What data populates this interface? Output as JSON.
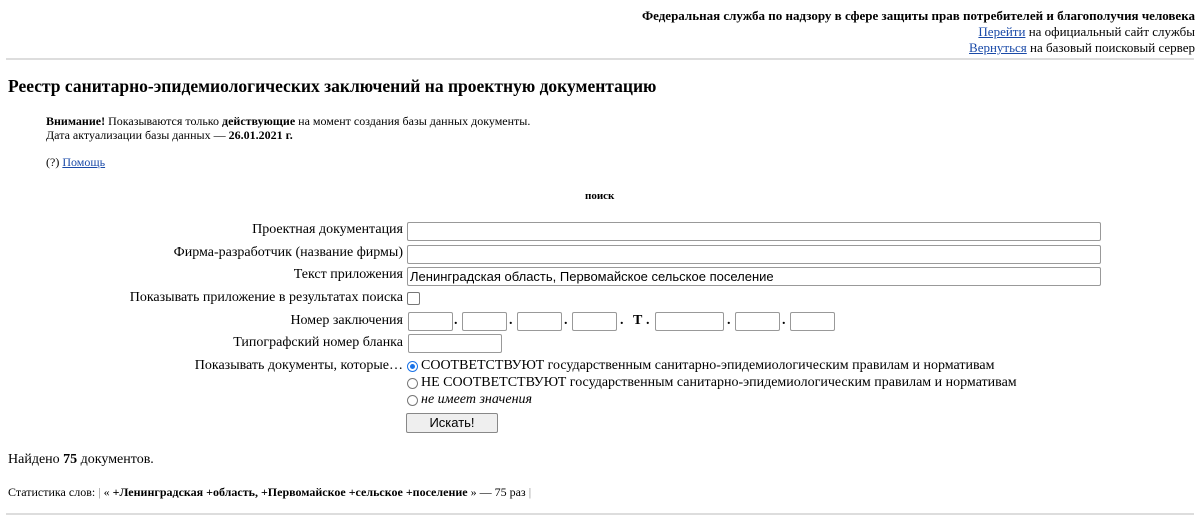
{
  "header": {
    "org": "Федеральная служба по надзору в сфере защиты прав потребителей и благополучия человека",
    "link1": "Перейти",
    "link1_rest": " на официальный сайт службы",
    "link2": "Вернуться",
    "link2_rest": " на базовый поисковый сервер"
  },
  "title": "Реестр санитарно-эпидемиологических заключений на проектную документацию",
  "notice": {
    "attention": "Внимание!",
    "text1": " Показываются только ",
    "active": "действующие",
    "text2": " на момент создания базы данных документы.",
    "date_label": "Дата актуализации базы данных — ",
    "date": "26.01.2021 г."
  },
  "help": {
    "prefix": "(?) ",
    "link": "Помощь"
  },
  "search": {
    "heading": "поиск",
    "labels": {
      "project": "Проектная документация",
      "firm": "Фирма-разработчик (название фирмы)",
      "text": "Текст приложения",
      "show_app": "Показывать приложение в результатах поиска",
      "number": "Номер заключения",
      "blank": "Типографский номер бланка",
      "show_docs": "Показывать документы, которые…"
    },
    "values": {
      "project": "",
      "firm": "",
      "text": "Ленинградская область, Первомайское сельское поселение",
      "blank": ""
    },
    "number_sep": ".",
    "number_t": "Т",
    "radio": [
      "СООТВЕТСТВУЮТ государственным санитарно-эпидемиологическим правилам и нормативам",
      "НЕ СООТВЕТСТВУЮТ государственным санитарно-эпидемиологическим правилам и нормативам",
      "не имеет значения"
    ],
    "button": "Искать!"
  },
  "results": {
    "found_prefix": "Найдено ",
    "count": "75",
    "found_suffix": " документов.",
    "stats_label": "Статистика слов: ",
    "stats_open": " « ",
    "stats_query": "+Ленинградская +область, +Первомайское +сельское +поселение",
    "stats_close": " » — 75 раз ",
    "pipe": "|"
  }
}
